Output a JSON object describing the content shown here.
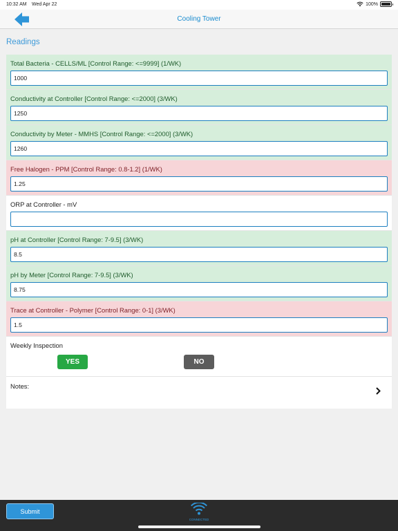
{
  "status_bar": {
    "time": "10:32 AM",
    "date": "Wed Apr 22",
    "battery": "100%"
  },
  "nav": {
    "title": "Cooling Tower",
    "back_icon": "back-arrow-icon"
  },
  "section": {
    "title": "Readings"
  },
  "readings": [
    {
      "label": "Total Bacteria - CELLS/ML [Control Range: <=9999] (1/WK)",
      "value": "1000",
      "status": "ok"
    },
    {
      "label": "Conductivity at Controller [Control Range: <=2000] (3/WK)",
      "value": "1250",
      "status": "ok"
    },
    {
      "label": "Conductivity by Meter - MMHS [Control Range: <=2000] (3/WK)",
      "value": "1260",
      "status": "ok"
    },
    {
      "label": "Free Halogen - PPM [Control Range: 0.8-1.2] (1/WK)",
      "value": "1.25",
      "status": "bad"
    },
    {
      "label": "ORP at Controller - mV",
      "value": "",
      "status": "none"
    },
    {
      "label": "pH at Controller [Control Range: 7-9.5] (3/WK)",
      "value": "8.5",
      "status": "ok"
    },
    {
      "label": "pH by Meter [Control Range: 7-9.5] (3/WK)",
      "value": "8.75",
      "status": "ok"
    },
    {
      "label": "Trace at Controller - Polymer [Control Range: 0-1] (3/WK)",
      "value": "1.5",
      "status": "bad"
    }
  ],
  "inspection": {
    "label": "Weekly Inspection",
    "yes_label": "YES",
    "no_label": "NO",
    "selected": "YES"
  },
  "notes": {
    "label": "Notes:"
  },
  "footer": {
    "submit_label": "Submit",
    "connection_label": "CONNECTED",
    "connection_icon": "wifi-icon"
  },
  "colors": {
    "accent": "#3d9ad9",
    "ok_row": "#d6eedb",
    "bad_row": "#f7d5d8",
    "yes_button": "#27a844",
    "no_button": "#5c5c5c",
    "bottom_bar": "#2b2b2b"
  }
}
